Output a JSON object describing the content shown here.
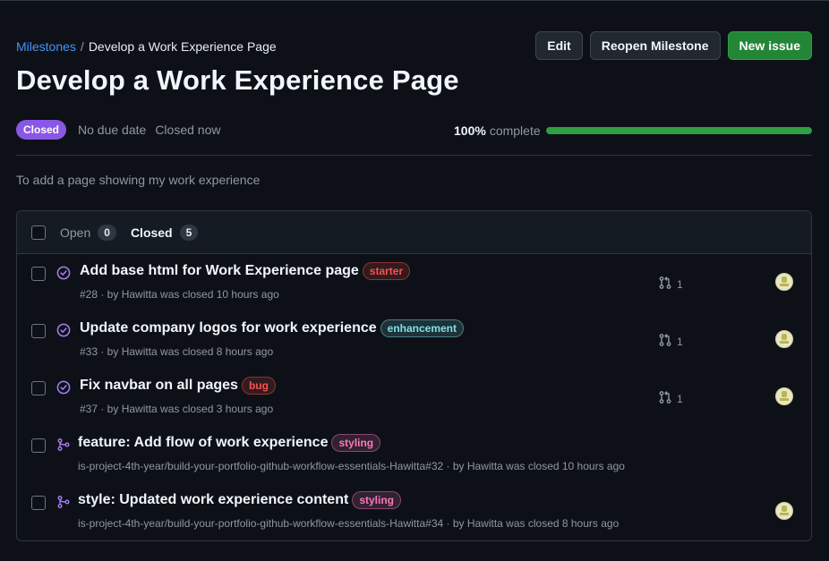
{
  "breadcrumb": {
    "parent": "Milestones",
    "separator": "/",
    "current": "Develop a Work Experience Page"
  },
  "title": "Develop a Work Experience Page",
  "actions": {
    "edit": "Edit",
    "reopen": "Reopen Milestone",
    "new_issue": "New issue"
  },
  "meta": {
    "state_badge": "Closed",
    "due": "No due date",
    "closed": "Closed now"
  },
  "progress": {
    "percent_label": "100%",
    "suffix": "complete",
    "fraction": 1.0
  },
  "description": "To add a page showing my work experience",
  "tabs": {
    "open": {
      "label": "Open",
      "count": "0"
    },
    "closed": {
      "label": "Closed",
      "count": "5"
    }
  },
  "items": [
    {
      "type": "issue",
      "title": "Add base html for Work Experience page",
      "label": "starter",
      "label_color": "#f85149",
      "sub": "#28 · by Hawitta was closed 10 hours ago",
      "linked": "1",
      "avatar": true
    },
    {
      "type": "issue",
      "title": "Update company logos for work experience",
      "label": "enhancement",
      "label_color": "#7ee0e8",
      "sub": "#33 · by Hawitta was closed 8 hours ago",
      "linked": "1",
      "avatar": true
    },
    {
      "type": "issue",
      "title": "Fix navbar on all pages",
      "label": "bug",
      "label_color": "#f85149",
      "sub": "#37 · by Hawitta was closed 3 hours ago",
      "linked": "1",
      "avatar": true
    },
    {
      "type": "pr",
      "title": "feature: Add flow of work experience",
      "label": "styling",
      "label_color": "#f778ba",
      "sub": "is-project-4th-year/build-your-portfolio-github-workflow-essentials-Hawitta#32 · by Hawitta was closed 10 hours ago",
      "linked": "",
      "avatar": false
    },
    {
      "type": "pr",
      "title": "style: Updated work experience content",
      "label": "styling",
      "label_color": "#f778ba",
      "sub": "is-project-4th-year/build-your-portfolio-github-workflow-essentials-Hawitta#34 · by Hawitta was closed 8 hours ago",
      "linked": "",
      "avatar": true
    }
  ],
  "colors": {
    "accent_link": "#4493f8",
    "closed_purple": "#8957e5",
    "success_green": "#2ea043"
  }
}
